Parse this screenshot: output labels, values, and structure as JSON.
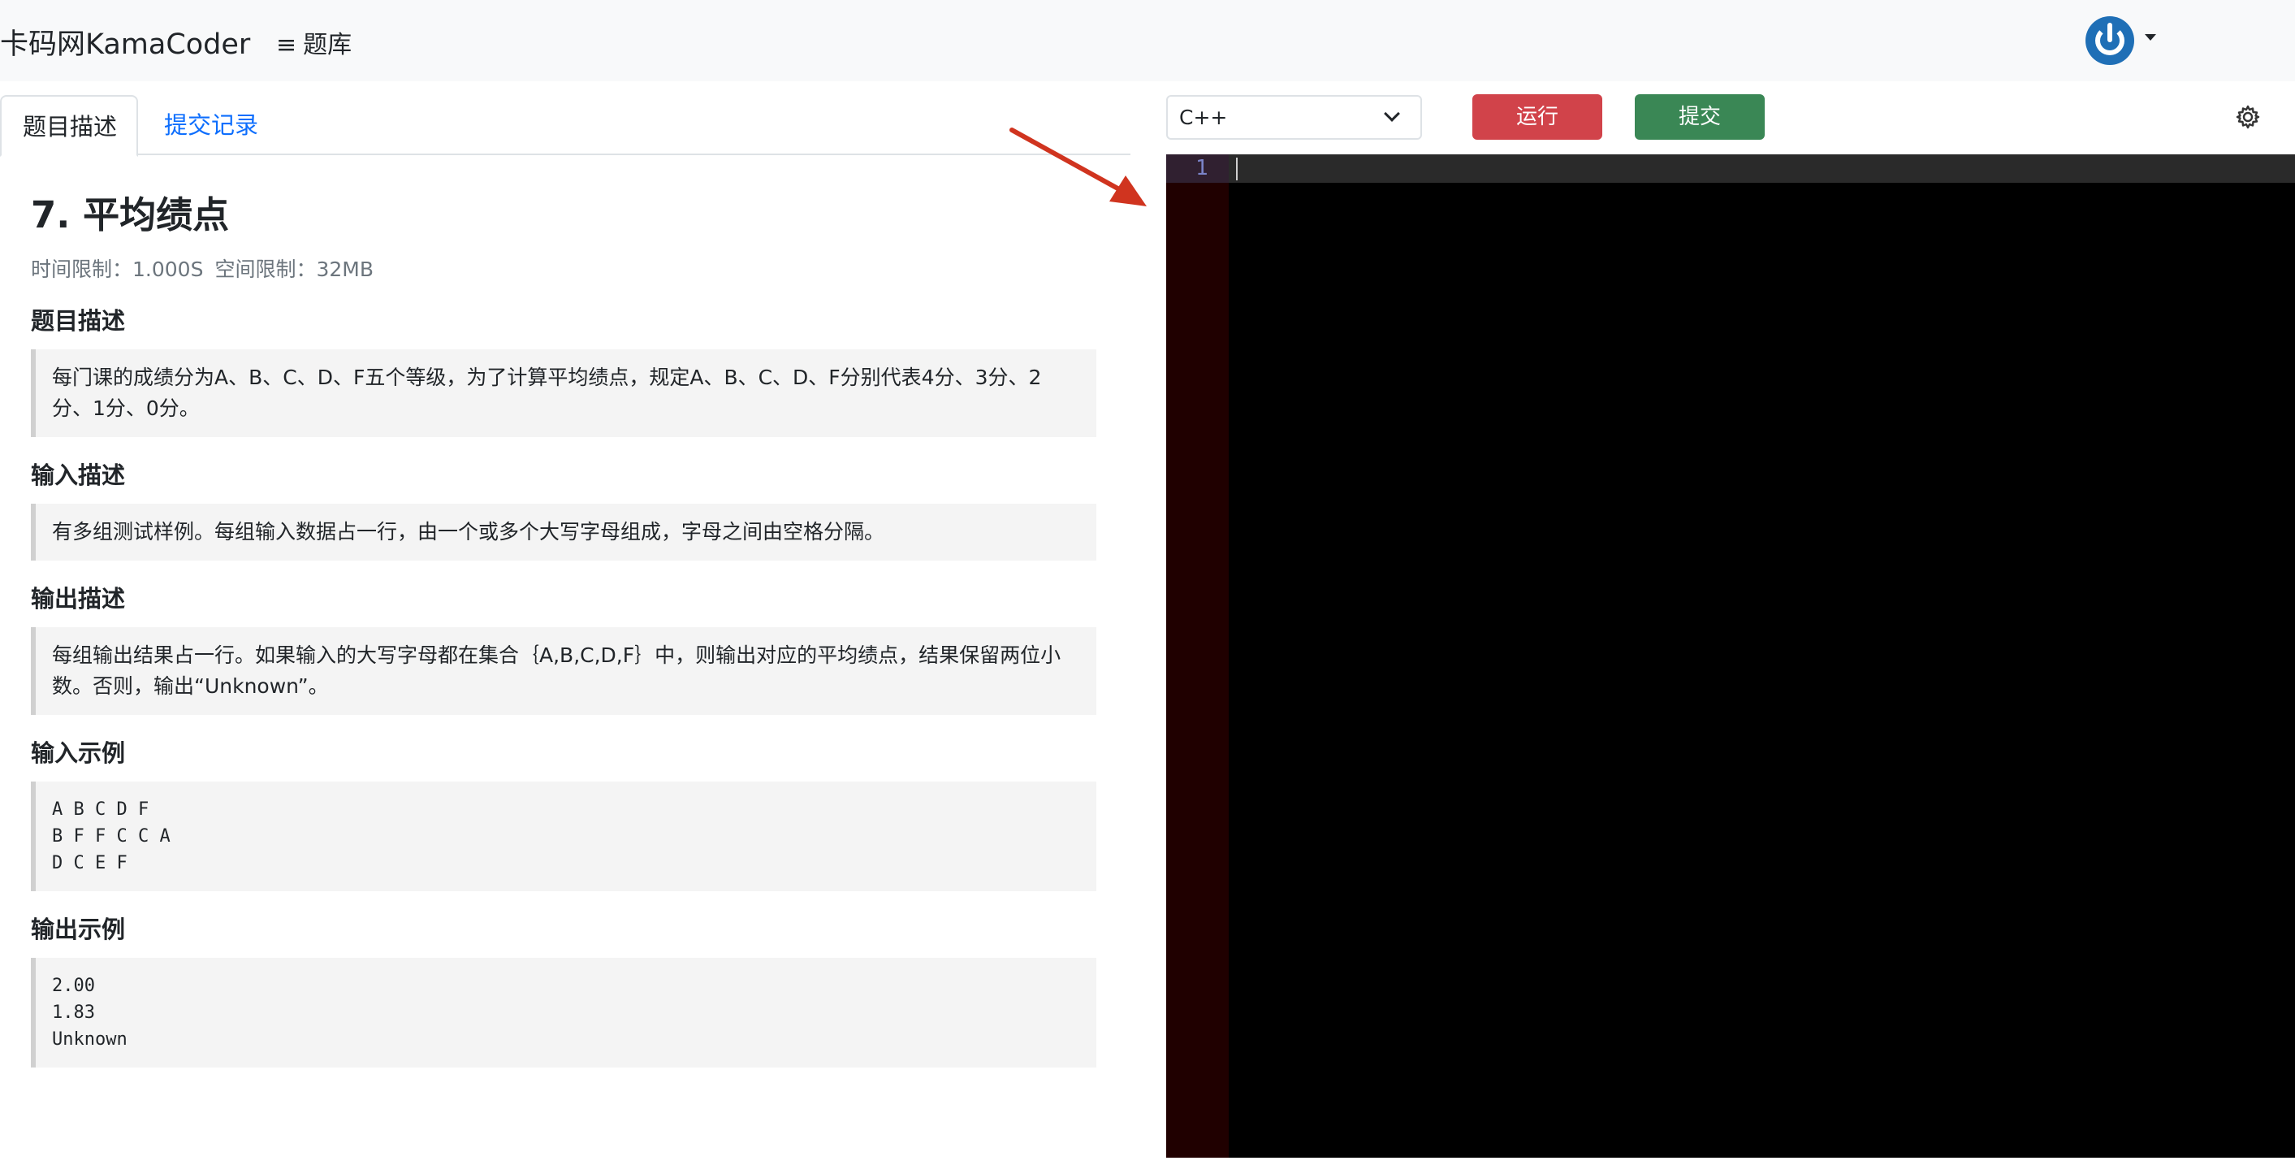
{
  "nav": {
    "brand": "卡码网KamaCoder",
    "menu_icon": "≡",
    "menu_label": "题库",
    "avatar_icon": "power-icon"
  },
  "tabs": [
    {
      "label": "题目描述",
      "active": true
    },
    {
      "label": "提交记录",
      "active": false
    }
  ],
  "problem": {
    "title": "7. 平均绩点",
    "time_limit": "时间限制：1.000S",
    "memory_limit": "空间限制：32MB",
    "sections": {
      "desc": {
        "heading": "题目描述",
        "text": "每门课的成绩分为A、B、C、D、F五个等级，为了计算平均绩点，规定A、B、C、D、F分别代表4分、3分、2分、1分、0分。"
      },
      "input": {
        "heading": "输入描述",
        "text": "有多组测试样例。每组输入数据占一行，由一个或多个大写字母组成，字母之间由空格分隔。"
      },
      "output": {
        "heading": "输出描述",
        "text": "每组输出结果占一行。如果输入的大写字母都在集合｛A,B,C,D,F｝中，则输出对应的平均绩点，结果保留两位小数。否则，输出“Unknown”。"
      },
      "sample_input": {
        "heading": "输入示例",
        "text": "A B C D F\nB F F C C A\nD C E F"
      },
      "sample_output": {
        "heading": "输出示例",
        "text": "2.00\n1.83\nUnknown"
      }
    }
  },
  "editor": {
    "language": "C++",
    "run_label": "运行",
    "submit_label": "提交",
    "line_numbers": [
      "1"
    ],
    "code": "",
    "colors": {
      "run": "#d1434a",
      "submit": "#3a8755",
      "editor_bg": "#000000"
    }
  }
}
